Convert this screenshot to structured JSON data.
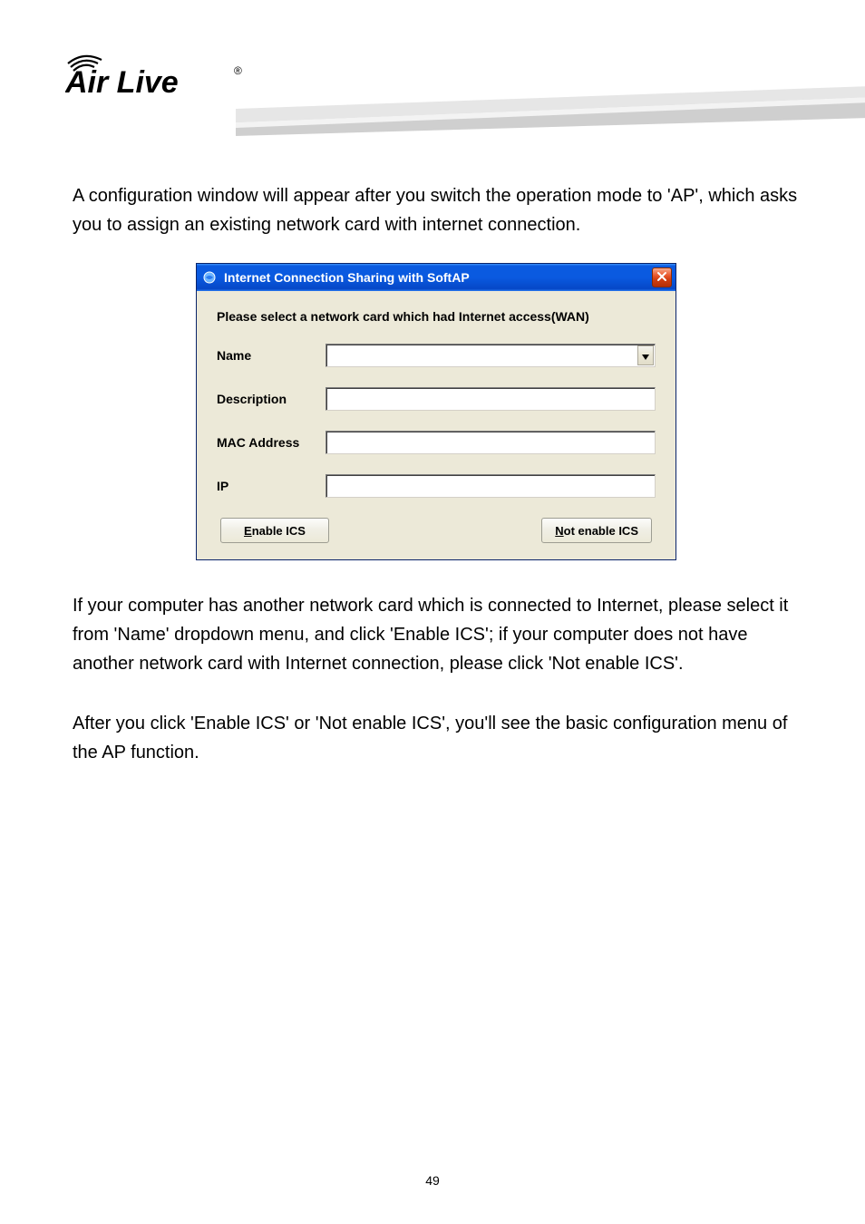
{
  "logo": {
    "brand_text": "Air Live",
    "registered": "®"
  },
  "content": {
    "para1": "A configuration window will appear after you switch the operation mode to 'AP', which asks you to assign an existing network card with internet connection.",
    "para2": "If your computer has another network card which is connected to Internet, please select it from 'Name' dropdown menu, and click 'Enable ICS'; if your computer does not have another network card with Internet connection, please click 'Not enable ICS'.",
    "para3": "After you click 'Enable ICS' or 'Not enable ICS', you'll see the basic configuration menu of the AP function."
  },
  "dialog": {
    "title": "Internet  Connection Sharing with SoftAP",
    "prompt": "Please select a network card which had Internet access(WAN)",
    "labels": {
      "name": "Name",
      "description": "Description",
      "mac": "MAC Address",
      "ip": "IP"
    },
    "fields": {
      "name_value": "",
      "description_value": "",
      "mac_value": "",
      "ip_value": ""
    },
    "buttons": {
      "enable_pre": "E",
      "enable_post": "nable ICS",
      "notenable_pre": "N",
      "notenable_post": "ot enable ICS"
    }
  },
  "page_number": "49"
}
